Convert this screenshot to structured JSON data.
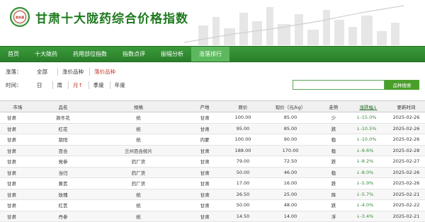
{
  "header": {
    "logo_text": "陇本源",
    "title": "甘肃十大陇药综合价格指数"
  },
  "nav": [
    "首页",
    "十大陇药",
    "药用部位指数",
    "指数点评",
    "振幅分析",
    "涨落排行"
  ],
  "filters": {
    "type_label": "涨落：",
    "types": [
      "全部",
      "涨价品种",
      "落价品种"
    ],
    "time_label": "时间：",
    "times": [
      "日",
      "周",
      "月↑",
      "季度",
      "年度"
    ],
    "search_button": "品种搜索",
    "search_value": ""
  },
  "table": {
    "headers": [
      "市场",
      "品名",
      "规格",
      "产地",
      "原价",
      "现价（元/kg）",
      "走势",
      "涨跌幅↓",
      "更新时间"
    ],
    "rows": [
      [
        "甘肃",
        "款冬花",
        "统",
        "甘肃",
        "100.00",
        "85.00",
        "少",
        "↓-15.0%",
        "2025-02-26"
      ],
      [
        "甘肃",
        "红花",
        "统",
        "甘肃",
        "95.00",
        "85.00",
        "跌",
        "↓-10.5%",
        "2025-02-26"
      ],
      [
        "甘肃",
        "锁阳",
        "统",
        "内蒙",
        "100.00",
        "90.00",
        "稳",
        "↓-10.0%",
        "2025-02-26"
      ],
      [
        "甘肃",
        "百合",
        "兰州百合统片",
        "甘肃",
        "188.00",
        "170.00",
        "稳",
        "↓-9.6%",
        "2025-02-28"
      ],
      [
        "甘肃",
        "党参",
        "药厂货",
        "甘肃",
        "79.00",
        "72.50",
        "跌",
        "↓-8.2%",
        "2025-02-27"
      ],
      [
        "甘肃",
        "当归",
        "药厂货",
        "甘肃",
        "50.00",
        "46.00",
        "稳",
        "↓-8.0%",
        "2025-02-26"
      ],
      [
        "甘肃",
        "黄芪",
        "药厂货",
        "甘肃",
        "17.00",
        "16.00",
        "跌",
        "↓-5.9%",
        "2025-02-26"
      ],
      [
        "甘肃",
        "玫瑰",
        "统",
        "甘肃",
        "26.50",
        "25.00",
        "降",
        "↓-5.7%",
        "2025-02-21"
      ],
      [
        "甘肃",
        "红芪",
        "统",
        "甘肃",
        "50.00",
        "48.00",
        "跌",
        "↓-4.0%",
        "2025-02-22"
      ],
      [
        "甘肃",
        "丹参",
        "统",
        "甘肃",
        "14.50",
        "14.00",
        "浮",
        "↓-3.4%",
        "2025-02-21"
      ]
    ]
  },
  "colors": {
    "brand_green": "#2a7f2a",
    "active_tab": "#5db85d",
    "selected_red": "#c0392b"
  }
}
